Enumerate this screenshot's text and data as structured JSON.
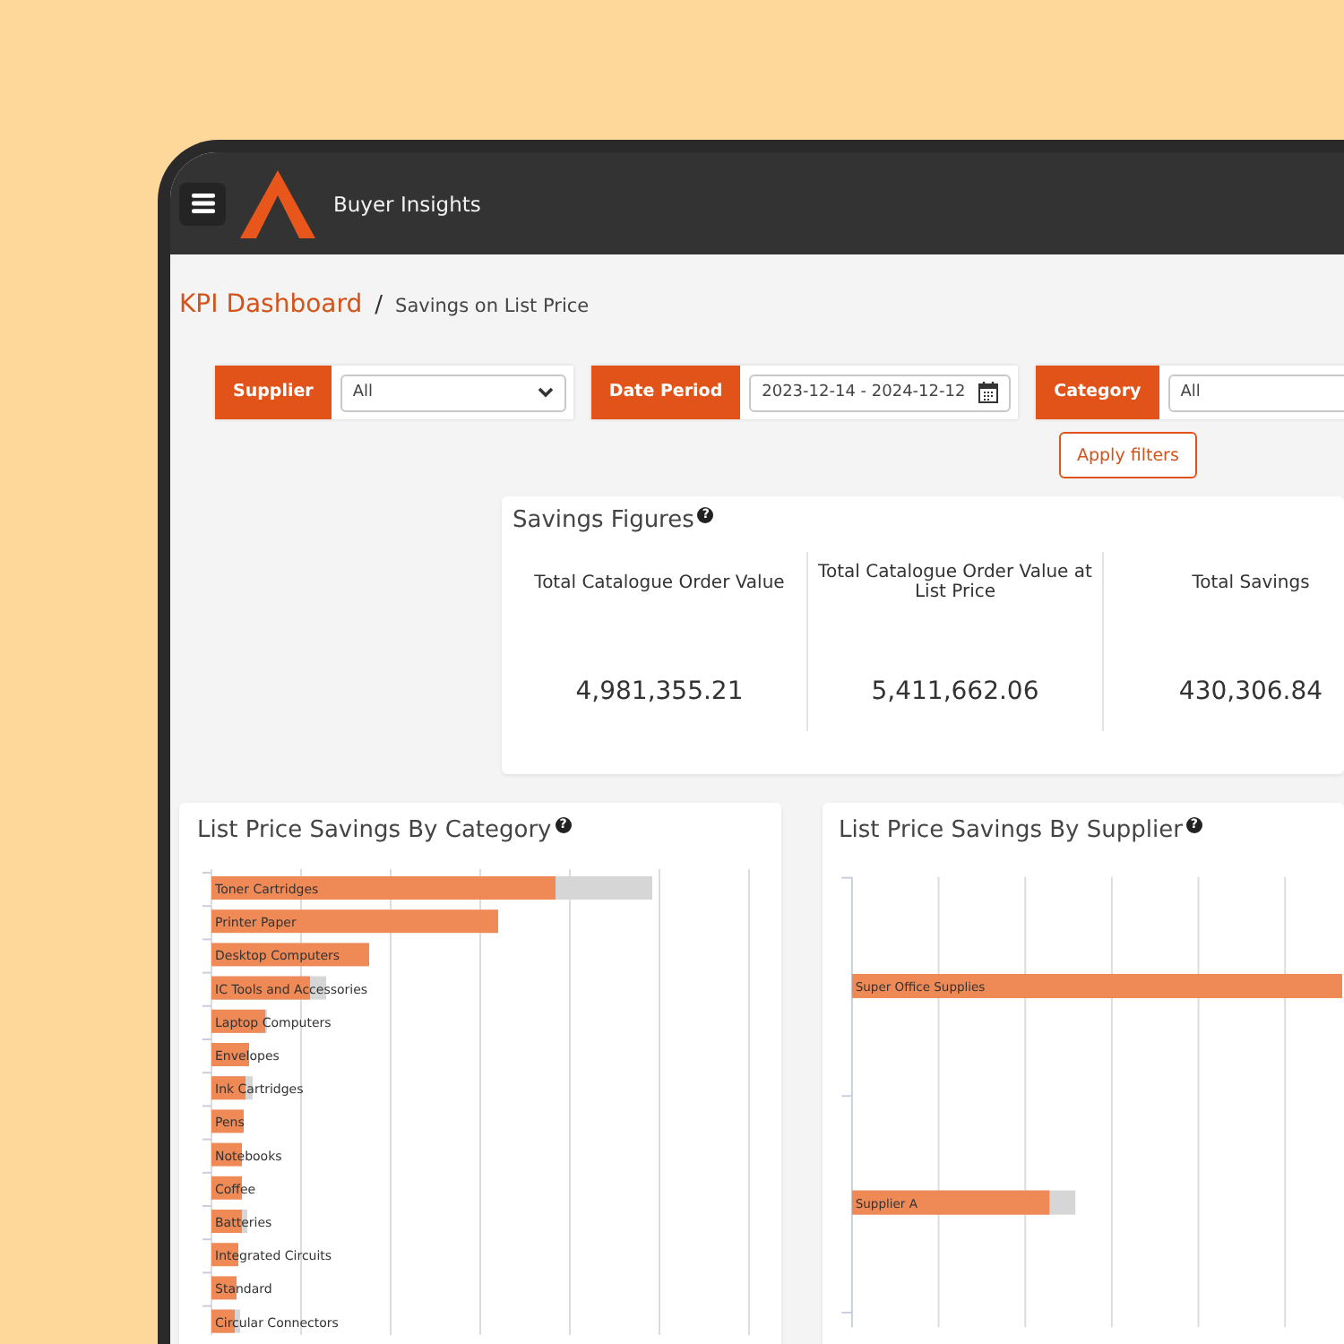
{
  "app": {
    "title": "Buyer Insights"
  },
  "breadcrumb": {
    "parent": "KPI Dashboard",
    "separator": "/",
    "current": "Savings on List Price"
  },
  "filters": [
    {
      "label": "Supplier",
      "kind": "select",
      "value": "All"
    },
    {
      "label": "Date Period",
      "kind": "date",
      "value": "2023-12-14 - 2024-12-12"
    },
    {
      "label": "Category",
      "kind": "field",
      "value": "All"
    }
  ],
  "apply_button": "Apply filters",
  "savings_figures": {
    "title": "Savings Figures",
    "help": "?",
    "figures": [
      {
        "label": "Total Catalogue Order Value",
        "value": "4,981,355.21"
      },
      {
        "label": "Total Catalogue Order Value at List Price",
        "value": "5,411,662.06"
      },
      {
        "label": "Total Savings",
        "value": "430,306.84"
      }
    ]
  },
  "category_chart": {
    "title": "List Price Savings By Category",
    "help": "?",
    "bars": [
      "Toner Cartridges",
      "Printer Paper",
      "Desktop Computers",
      "IC Tools and Accessories",
      "Laptop Computers",
      "Envelopes",
      "Ink Cartridges",
      "Pens",
      "Notebooks",
      "Coffee",
      "Batteries",
      "Integrated Circuits",
      "Standard",
      "Circular Connectors"
    ]
  },
  "supplier_chart": {
    "title": "List Price Savings By Supplier",
    "help": "?",
    "bars": [
      "Super Office Supplies",
      "Supplier A"
    ]
  }
}
